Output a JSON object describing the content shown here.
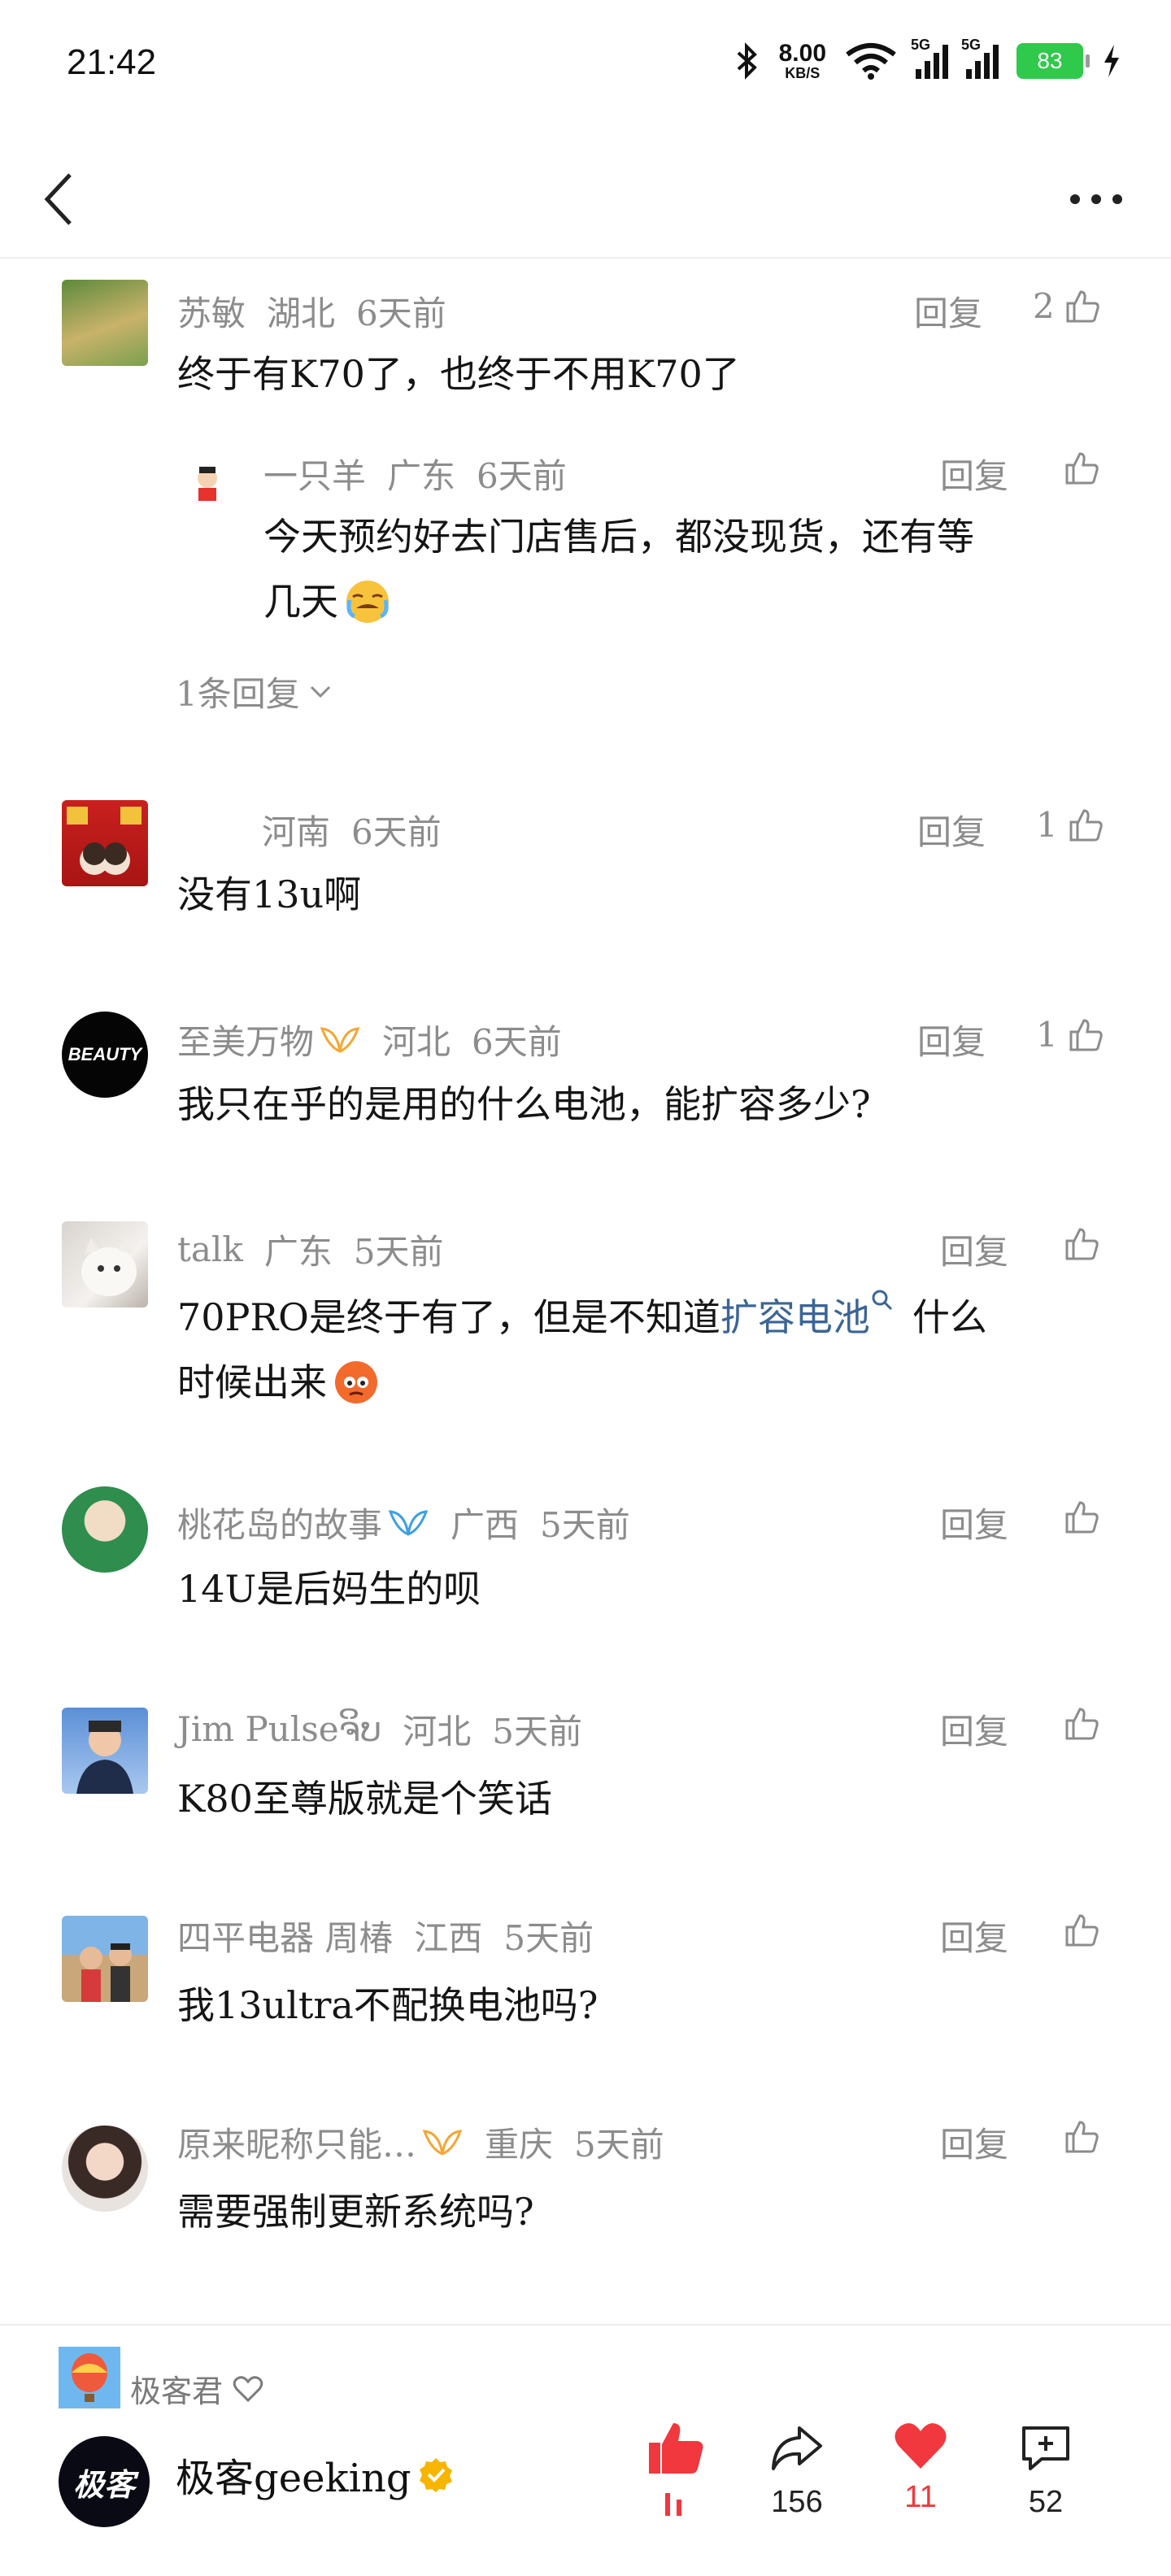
{
  "status_bar": {
    "time": "21:42",
    "net_speed": "8.00",
    "net_unit": "KB/S",
    "signal1": "5G",
    "signal2": "5G",
    "battery": "83",
    "battery_color": "#2fc94b"
  },
  "comments": [
    {
      "user": "苏敏",
      "region": "湖北",
      "time": "6天前",
      "reply": "回复",
      "likes": "2",
      "text": "终于有K70了，也终于不用K70了"
    },
    {
      "user": "一只羊",
      "region": "广东",
      "time": "6天前",
      "reply": "回复",
      "likes": "",
      "text_line1": "今天预约好去门店售后，都没现货，还有等",
      "text_line2": "几天",
      "more_replies": "1条回复"
    },
    {
      "user": "",
      "region": "河南",
      "time": "6天前",
      "reply": "回复",
      "likes": "1",
      "text": "没有13u啊"
    },
    {
      "user": "至美万物",
      "region": "河北",
      "time": "6天前",
      "reply": "回复",
      "likes": "1",
      "text": "我只在乎的是用的什么电池，能扩容多少?",
      "avatar_text": "BEAUTY"
    },
    {
      "user": "talk",
      "region": "广东",
      "time": "5天前",
      "reply": "回复",
      "likes": "",
      "text_part1": "70PRO是终于有了，但是不知道",
      "text_keyword": "扩容电池",
      "text_part2": "什么",
      "text_line2": "时候出来"
    },
    {
      "user": "桃花岛的故事",
      "region": "广西",
      "time": "5天前",
      "reply": "回复",
      "likes": "",
      "text": "14U是后妈生的呗"
    },
    {
      "user": "Jim Pulseຈິບ",
      "region": "河北",
      "time": "5天前",
      "reply": "回复",
      "likes": "",
      "text": "K80至尊版就是个笑话"
    },
    {
      "user": "四平电器 周椿",
      "region": "江西",
      "time": "5天前",
      "reply": "回复",
      "likes": "",
      "text": "我13ultra不配换电池吗?"
    },
    {
      "user": "原来昵称只能…",
      "region": "重庆",
      "time": "5天前",
      "reply": "回复",
      "likes": "",
      "text": "需要强制更新系统吗?"
    }
  ],
  "footer": {
    "author_small": "极客君",
    "author_name": "极客geeking",
    "author_avatar_text": "极客",
    "share_count": "156",
    "like_count": "11",
    "comment_count": "52",
    "like_color": "#f0383e"
  }
}
